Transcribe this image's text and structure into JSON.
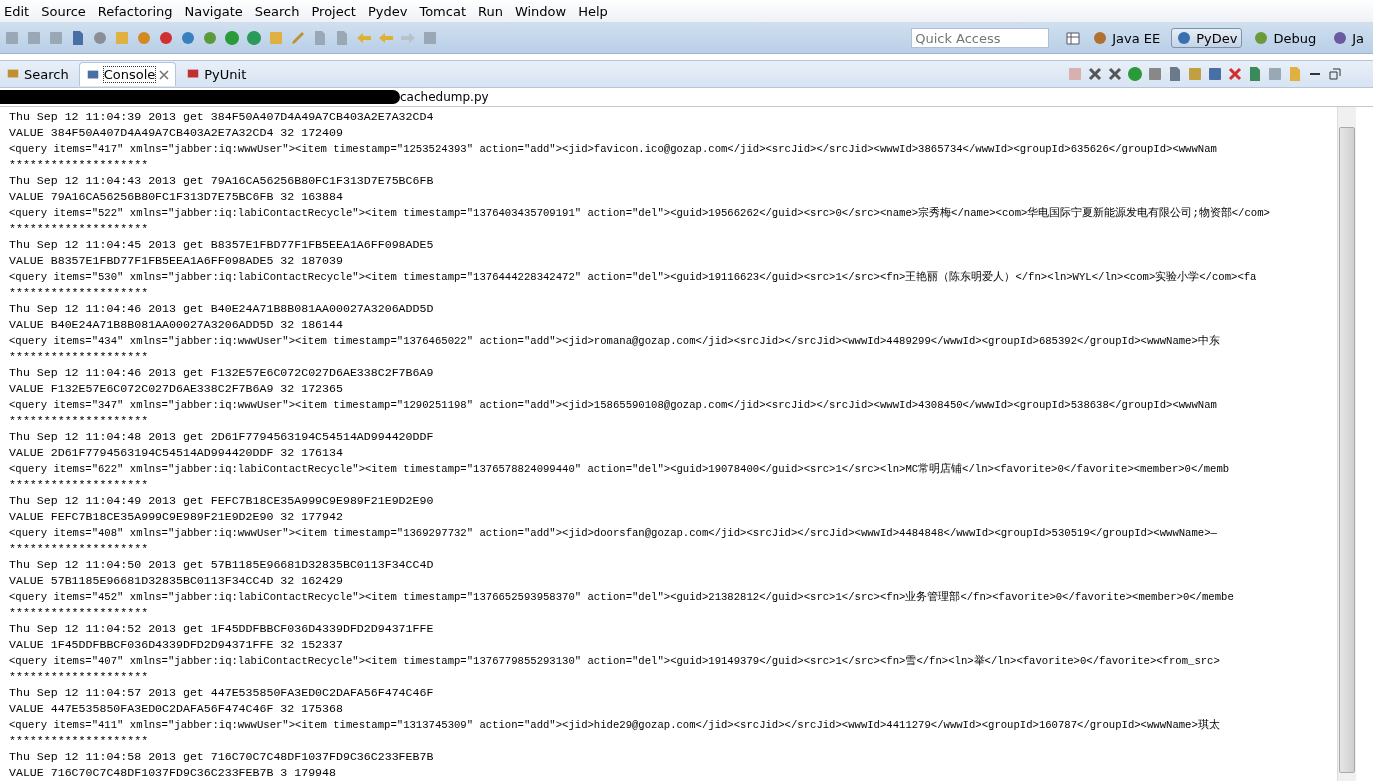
{
  "menu": [
    "Edit",
    "Source",
    "Refactoring",
    "Navigate",
    "Search",
    "Project",
    "Pydev",
    "Tomcat",
    "Run",
    "Window",
    "Help"
  ],
  "quick_access": {
    "placeholder": "Quick Access"
  },
  "perspectives": [
    {
      "label": "Java EE",
      "selected": false
    },
    {
      "label": "PyDev",
      "selected": true
    },
    {
      "label": "Debug",
      "selected": false
    },
    {
      "label": "Ja",
      "selected": false
    }
  ],
  "view_tabs": [
    {
      "label": "Search",
      "selected": false,
      "closable": false
    },
    {
      "label": "Console",
      "selected": true,
      "closable": true
    },
    {
      "label": "PyUnit",
      "selected": false,
      "closable": false
    }
  ],
  "console": {
    "title": "cachedump.py",
    "redacted": true,
    "entries": [
      {
        "get": "Thu Sep 12 11:04:39 2013 get 384F50A407D4A49A7CB403A2E7A32CD4",
        "value": "VALUE 384F50A407D4A49A7CB403A2E7A32CD4 32 172409",
        "query": "<query items=\"417\" xmlns=\"jabber:iq:wwwUser\"><item timestamp=\"1253524393\" action=\"add\"><jid>favicon.ico@gozap.com</jid><srcJid></srcJid><wwwId>3865734</wwwId><groupId>635626</groupId><wwwNam",
        "separator": "********************"
      },
      {
        "get": "Thu Sep 12 11:04:43 2013 get 79A16CA56256B80FC1F313D7E75BC6FB",
        "value": "VALUE 79A16CA56256B80FC1F313D7E75BC6FB 32 163884",
        "query": "<query items=\"522\" xmlns=\"jabber:iq:labiContactRecycle\"><item timestamp=\"1376403435709191\" action=\"del\"><guid>19566262</guid><src>0</src><name>宗秀梅</name><com>华电国际宁夏新能源发电有限公司;物资部</com>",
        "separator": "********************"
      },
      {
        "get": "Thu Sep 12 11:04:45 2013 get B8357E1FBD77F1FB5EEA1A6FF098ADE5",
        "value": "VALUE B8357E1FBD77F1FB5EEA1A6FF098ADE5 32 187039",
        "query": "<query items=\"530\" xmlns=\"jabber:iq:labiContactRecycle\"><item timestamp=\"1376444228342472\" action=\"del\"><guid>19116623</guid><src>1</src><fn>王艳丽（陈东明爱人）</fn><ln>WYL</ln><com>实验小学</com><fa",
        "separator": "********************"
      },
      {
        "get": "Thu Sep 12 11:04:46 2013 get B40E24A71B8B081AA00027A3206ADD5D",
        "value": "VALUE B40E24A71B8B081AA00027A3206ADD5D 32 186144",
        "query": "<query items=\"434\" xmlns=\"jabber:iq:wwwUser\"><item timestamp=\"1376465022\" action=\"add\"><jid>romana@gozap.com</jid><srcJid></srcJid><wwwId>4489299</wwwId><groupId>685392</groupId><wwwName>中东",
        "separator": "********************"
      },
      {
        "get": "Thu Sep 12 11:04:46 2013 get F132E57E6C072C027D6AE338C2F7B6A9",
        "value": "VALUE F132E57E6C072C027D6AE338C2F7B6A9 32 172365",
        "query": "<query items=\"347\" xmlns=\"jabber:iq:wwwUser\"><item timestamp=\"1290251198\" action=\"add\"><jid>15865590108@gozap.com</jid><srcJid></srcJid><wwwId>4308450</wwwId><groupId>538638</groupId><wwwNam",
        "separator": "********************"
      },
      {
        "get": "Thu Sep 12 11:04:48 2013 get 2D61F7794563194C54514AD994420DDF",
        "value": "VALUE 2D61F7794563194C54514AD994420DDF 32 176134",
        "query": "<query items=\"622\" xmlns=\"jabber:iq:labiContactRecycle\"><item timestamp=\"1376578824099440\" action=\"del\"><guid>19078400</guid><src>1</src><ln>MC常明店铺</ln><favorite>0</favorite><member>0</memb",
        "separator": "********************"
      },
      {
        "get": "Thu Sep 12 11:04:49 2013 get FEFC7B18CE35A999C9E989F21E9D2E90",
        "value": "VALUE FEFC7B18CE35A999C9E989F21E9D2E90 32 177942",
        "query": "<query items=\"408\" xmlns=\"jabber:iq:wwwUser\"><item timestamp=\"1369297732\" action=\"add\"><jid>doorsfan@gozap.com</jid><srcJid></srcJid><wwwId>4484848</wwwId><groupId>530519</groupId><wwwName>—",
        "separator": "********************"
      },
      {
        "get": "Thu Sep 12 11:04:50 2013 get 57B1185E96681D32835BC0113F34CC4D",
        "value": "VALUE 57B1185E96681D32835BC0113F34CC4D 32 162429",
        "query": "<query items=\"452\" xmlns=\"jabber:iq:labiContactRecycle\"><item timestamp=\"1376652593958370\" action=\"del\"><guid>21382812</guid><src>1</src><fn>业务管理部</fn><favorite>0</favorite><member>0</membe",
        "separator": "********************"
      },
      {
        "get": "Thu Sep 12 11:04:52 2013 get 1F45DDFBBCF036D4339DFD2D94371FFE",
        "value": "VALUE 1F45DDFBBCF036D4339DFD2D94371FFE 32 152337",
        "query": "<query items=\"407\" xmlns=\"jabber:iq:labiContactRecycle\"><item timestamp=\"1376779855293130\" action=\"del\"><guid>19149379</guid><src>1</src><fn>雪</fn><ln>举</ln><favorite>0</favorite><from_src>",
        "separator": "********************"
      },
      {
        "get": "Thu Sep 12 11:04:57 2013 get 447E535850FA3ED0C2DAFA56F474C46F",
        "value": "VALUE 447E535850FA3ED0C2DAFA56F474C46F 32 175368",
        "query": "<query items=\"411\" xmlns=\"jabber:iq:wwwUser\"><item timestamp=\"1313745309\" action=\"add\"><jid>hide29@gozap.com</jid><srcJid></srcJid><wwwId>4411279</wwwId><groupId>160787</groupId><wwwName>琪太",
        "separator": "********************"
      },
      {
        "get": "Thu Sep 12 11:04:58 2013 get 716C70C7C48DF1037FD9C36C233FEB7B",
        "value": "VALUE 716C70C7C48DF1037FD9C36C233FEB7B 3 179948"
      }
    ]
  }
}
